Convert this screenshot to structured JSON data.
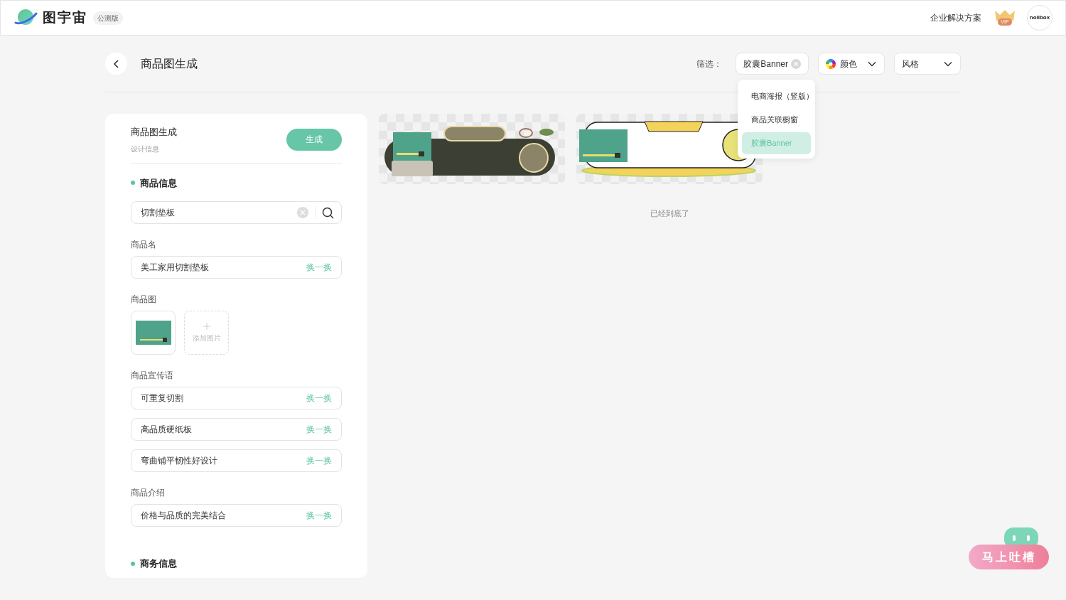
{
  "header": {
    "logo_text": "图宇宙",
    "badge": "公测版",
    "links": [
      "企业解决方案"
    ],
    "vip_label": "VIP",
    "avatar_text": "nolibox"
  },
  "page": {
    "title": "商品图生成"
  },
  "filters": {
    "label": "筛选：",
    "chips": [
      {
        "kind": "tag",
        "label": "胶囊Banner"
      },
      {
        "kind": "color",
        "label": "颜色"
      },
      {
        "kind": "select",
        "label": "风格"
      }
    ],
    "menu": [
      {
        "label": "电商海报（竖版）",
        "selected": false
      },
      {
        "label": "商品关联橱窗",
        "selected": false
      },
      {
        "label": "胶囊Banner",
        "selected": true
      }
    ]
  },
  "form": {
    "title": "商品图生成",
    "subtitle": "设计信息",
    "generate_button": "生成",
    "sections": [
      {
        "heading": "商品信息",
        "search": {
          "value": "切割垫板"
        },
        "groups": [
          {
            "kind": "text",
            "label": "商品名",
            "fields": [
              {
                "value": "美工家用切割垫板",
                "action": "换一换"
              }
            ]
          },
          {
            "kind": "images",
            "label": "商品图",
            "add_label": "添加图片"
          },
          {
            "kind": "text",
            "label": "商品宣传语",
            "fields": [
              {
                "value": "可重复切割",
                "action": "换一换"
              },
              {
                "value": "高品质硬纸板",
                "action": "换一换"
              },
              {
                "value": "弯曲铺平韧性好设计",
                "action": "换一换"
              }
            ]
          },
          {
            "kind": "text",
            "label": "商品介绍",
            "fields": [
              {
                "value": "价格与品质的完美结合",
                "action": "换一换"
              }
            ]
          }
        ]
      },
      {
        "heading": "商务信息"
      }
    ]
  },
  "results": {
    "end_text": "已经到底了"
  },
  "feedback": {
    "label": "马上吐槽"
  }
}
